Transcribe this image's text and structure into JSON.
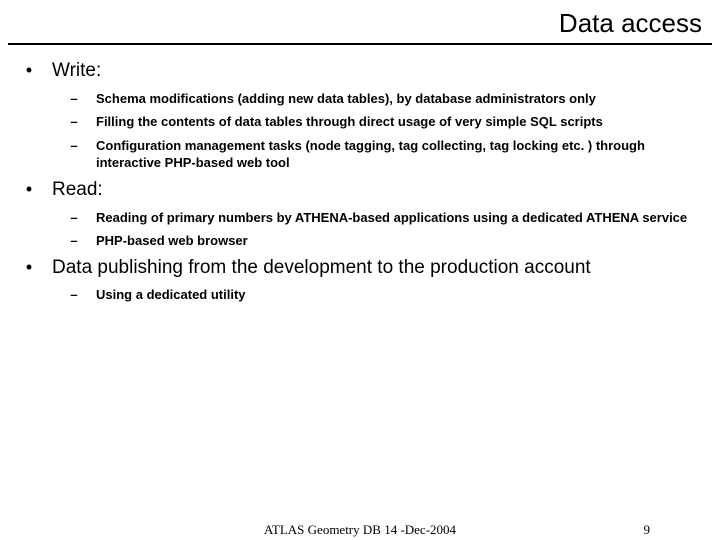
{
  "title": "Data access",
  "sections": [
    {
      "heading": "Write:",
      "items": [
        "Schema modifications (adding new data tables), by database administrators only",
        "Filling the contents of data tables through direct usage of very simple SQL scripts",
        "Configuration management tasks (node tagging, tag collecting, tag locking etc. ) through interactive PHP-based web tool"
      ]
    },
    {
      "heading": "Read:",
      "items": [
        "Reading of primary numbers by ATHENA-based applications using a dedicated ATHENA service",
        "PHP-based web browser"
      ]
    },
    {
      "heading": "Data publishing from the development to the production account",
      "items": [
        "Using a dedicated utility"
      ]
    }
  ],
  "footer_center": "ATLAS Geometry DB 14 -Dec-2004",
  "footer_page": "9",
  "bullet1": "•",
  "bullet2": "–"
}
